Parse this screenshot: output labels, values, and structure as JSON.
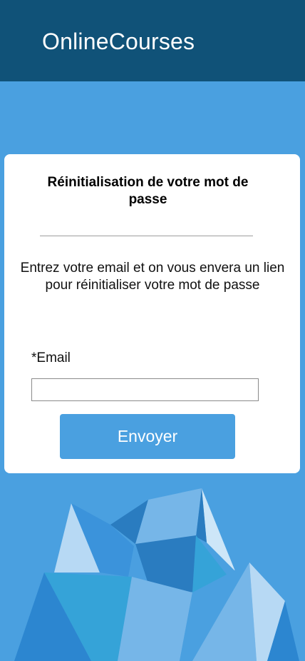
{
  "header": {
    "brand": "OnlineCourses",
    "background_color": "#105278"
  },
  "page": {
    "background_color": "#4aa0e0"
  },
  "reset_card": {
    "title": "Réinitialisation de votre mot de passe",
    "description": "Entrez votre email et on vous envera un lien pour réinitialiser votre mot de passe",
    "email_label": "*Email",
    "email_value": "",
    "submit_label": "Envoyer",
    "submit_color": "#4aa0e0"
  },
  "decoration": {
    "icon": "low-poly-iceberg-illustration"
  }
}
